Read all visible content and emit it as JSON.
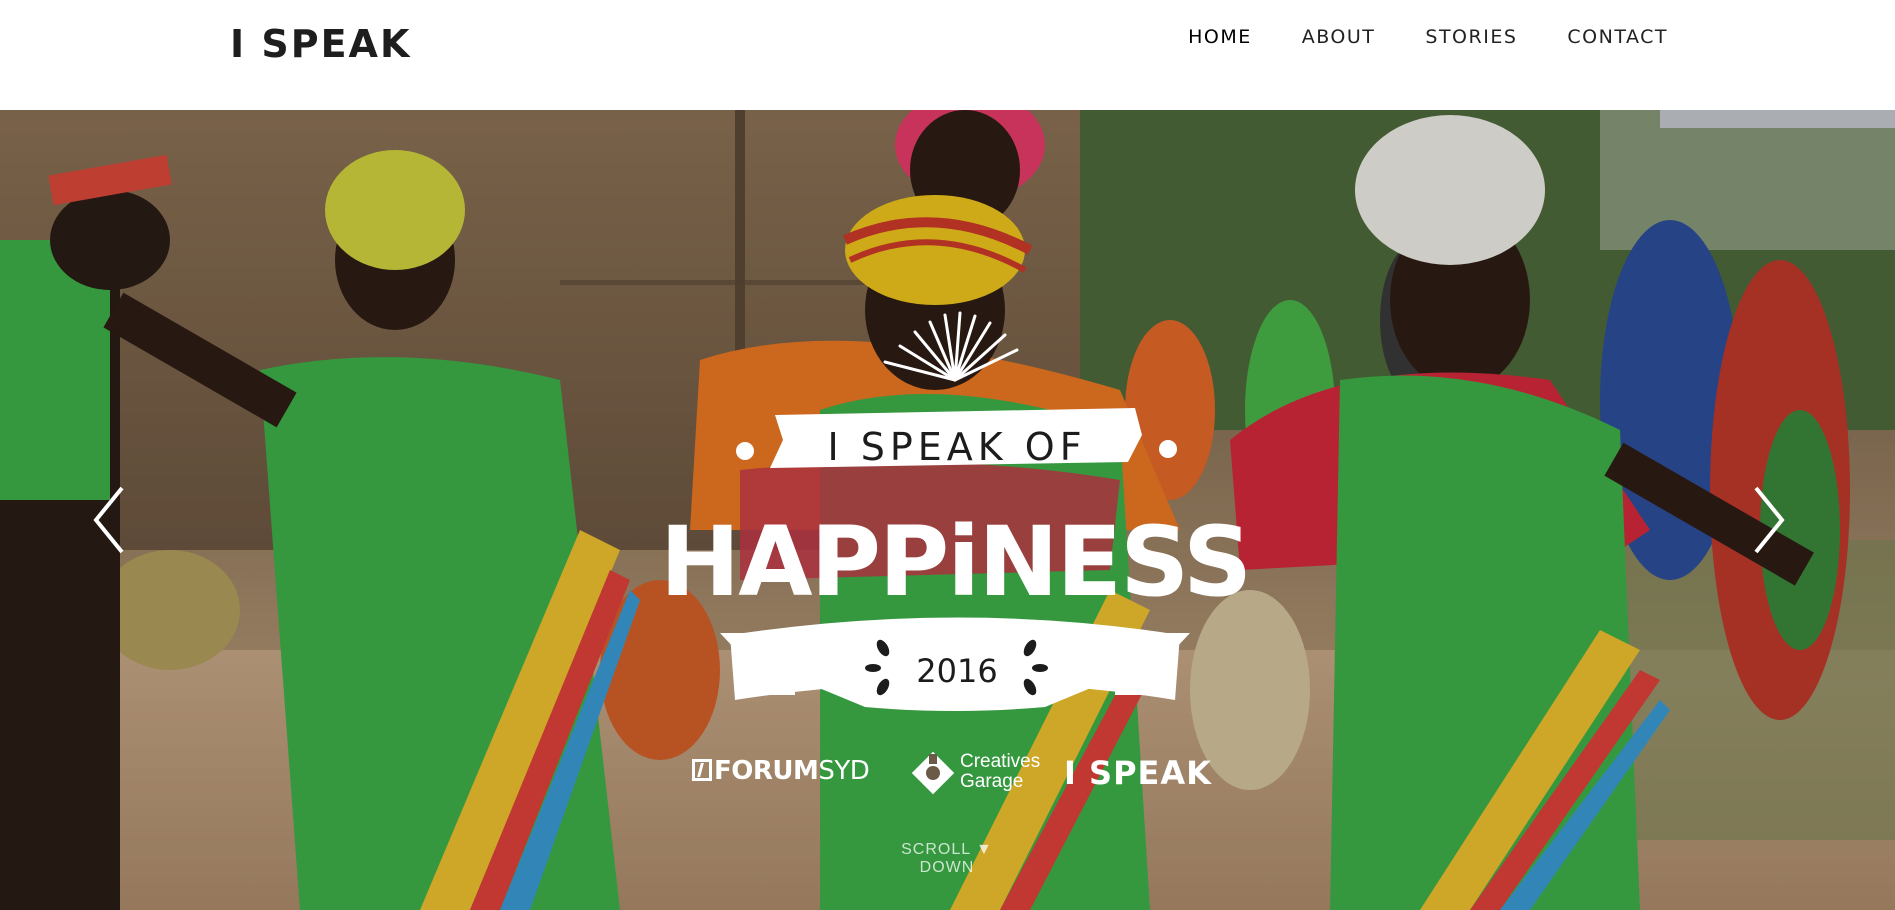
{
  "header": {
    "logo": "I SPEAK",
    "nav": [
      {
        "label": "HOME",
        "active": true
      },
      {
        "label": "ABOUT",
        "active": false
      },
      {
        "label": "STORIES",
        "active": false
      },
      {
        "label": "CONTACT",
        "active": false
      }
    ]
  },
  "hero": {
    "badge": {
      "line1": "I SPEAK OF",
      "line2": "HAPPiNESS",
      "year": "2016"
    },
    "partners": {
      "forum_bold": "FORUM",
      "forum_light": "SYD",
      "creatives_line1": "Creatives",
      "creatives_line2": "Garage",
      "ispeak": "I SPEAK"
    },
    "scroll_left": "SCROLL",
    "scroll_glyph": "▼",
    "scroll_right": "DOWN",
    "prev_icon": "chevron-left-icon",
    "next_icon": "chevron-right-icon"
  },
  "colors": {
    "header_bg": "#ffffff",
    "overlay_text": "#ffffff",
    "dress_green": "#3fb34a"
  }
}
